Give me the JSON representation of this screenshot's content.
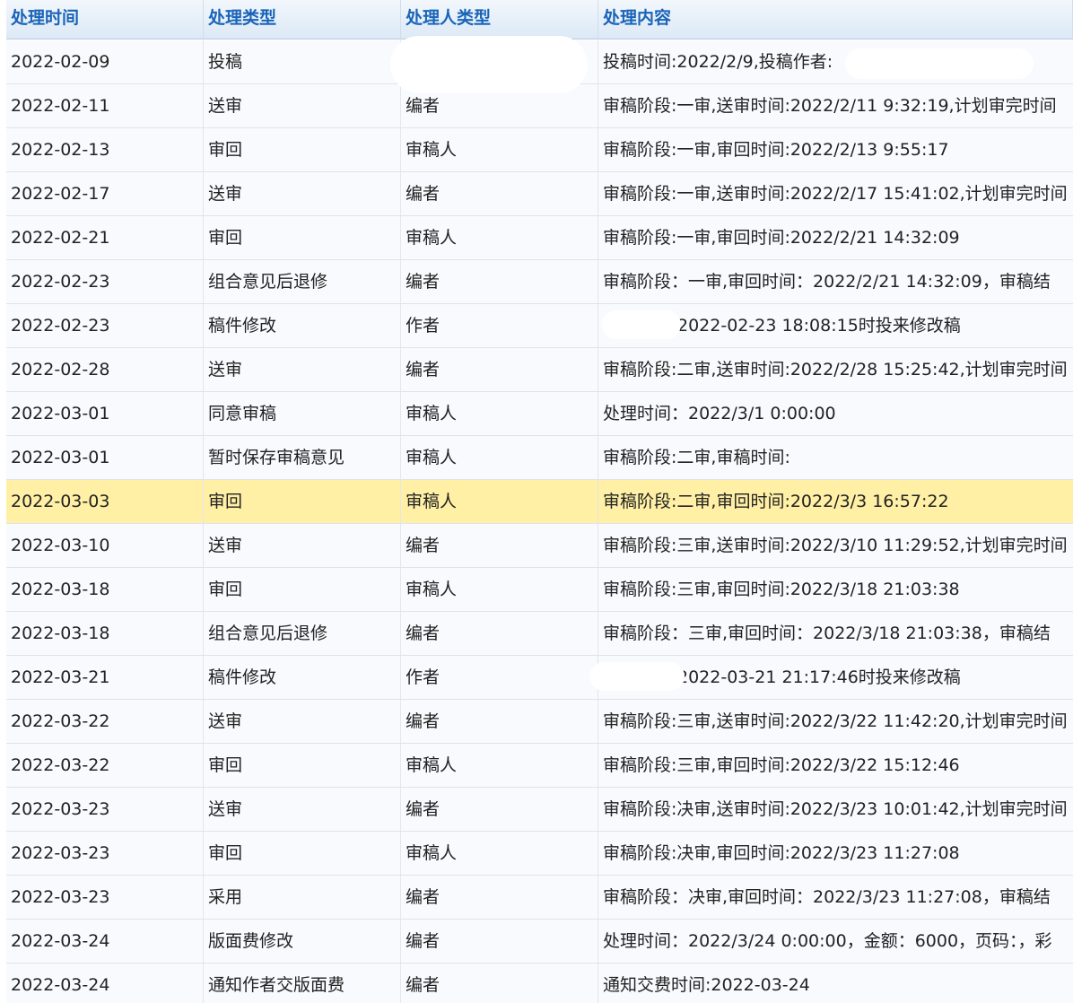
{
  "columns": [
    "处理时间",
    "处理类型",
    "处理人类型",
    "处理内容"
  ],
  "rows": [
    {
      "time": "2022-02-09",
      "type": "投稿",
      "role": "",
      "content": "投稿时间:2022/2/9,投稿作者:"
    },
    {
      "time": "2022-02-11",
      "type": "送审",
      "role": "编者",
      "content": "审稿阶段:一审,送审时间:2022/2/11 9:32:19,计划审完时间"
    },
    {
      "time": "2022-02-13",
      "type": "审回",
      "role": "审稿人",
      "content": "审稿阶段:一审,审回时间:2022/2/13 9:55:17"
    },
    {
      "time": "2022-02-17",
      "type": "送审",
      "role": "编者",
      "content": "审稿阶段:一审,送审时间:2022/2/17 15:41:02,计划审完时间"
    },
    {
      "time": "2022-02-21",
      "type": "审回",
      "role": "审稿人",
      "content": "审稿阶段:一审,审回时间:2022/2/21 14:32:09"
    },
    {
      "time": "2022-02-23",
      "type": "组合意见后退修",
      "role": "编者",
      "content": "审稿阶段：一审,审回时间：2022/2/21 14:32:09，审稿结"
    },
    {
      "time": "2022-02-23",
      "type": "稿件修改",
      "role": "作者",
      "content": "2022-02-23 18:08:15时投来修改稿"
    },
    {
      "time": "2022-02-28",
      "type": "送审",
      "role": "编者",
      "content": "审稿阶段:二审,送审时间:2022/2/28 15:25:42,计划审完时间"
    },
    {
      "time": "2022-03-01",
      "type": "同意审稿",
      "role": "审稿人",
      "content": "处理时间：2022/3/1 0:00:00"
    },
    {
      "time": "2022-03-01",
      "type": "暂时保存审稿意见",
      "role": "审稿人",
      "content": "审稿阶段:二审,审稿时间:"
    },
    {
      "time": "2022-03-03",
      "type": "审回",
      "role": "审稿人",
      "content": "审稿阶段:二审,审回时间:2022/3/3 16:57:22",
      "selected": true
    },
    {
      "time": "2022-03-10",
      "type": "送审",
      "role": "编者",
      "content": "审稿阶段:三审,送审时间:2022/3/10 11:29:52,计划审完时间"
    },
    {
      "time": "2022-03-18",
      "type": "审回",
      "role": "审稿人",
      "content": "审稿阶段:三审,审回时间:2022/3/18 21:03:38"
    },
    {
      "time": "2022-03-18",
      "type": "组合意见后退修",
      "role": "编者",
      "content": "审稿阶段：三审,审回时间：2022/3/18 21:03:38，审稿结"
    },
    {
      "time": "2022-03-21",
      "type": "稿件修改",
      "role": "作者",
      "content": "2022-03-21 21:17:46时投来修改稿"
    },
    {
      "time": "2022-03-22",
      "type": "送审",
      "role": "编者",
      "content": "审稿阶段:三审,送审时间:2022/3/22 11:42:20,计划审完时间"
    },
    {
      "time": "2022-03-22",
      "type": "审回",
      "role": "审稿人",
      "content": "审稿阶段:三审,审回时间:2022/3/22 15:12:46"
    },
    {
      "time": "2022-03-23",
      "type": "送审",
      "role": "编者",
      "content": "审稿阶段:决审,送审时间:2022/3/23 10:01:42,计划审完时间"
    },
    {
      "time": "2022-03-23",
      "type": "审回",
      "role": "审稿人",
      "content": "审稿阶段:决审,审回时间:2022/3/23 11:27:08"
    },
    {
      "time": "2022-03-23",
      "type": "采用",
      "role": "编者",
      "content": "审稿阶段：决审,审回时间：2022/3/23 11:27:08，审稿结"
    },
    {
      "time": "2022-03-24",
      "type": "版面费修改",
      "role": "编者",
      "content": "处理时间：2022/3/24 0:00:00，金额：6000，页码：，彩"
    },
    {
      "time": "2022-03-24",
      "type": "通知作者交版面费",
      "role": "编者",
      "content": "通知交费时间:2022-03-24"
    }
  ],
  "colors": {
    "header_text": "#1a64b8",
    "selected_row": "#fff0a6"
  }
}
